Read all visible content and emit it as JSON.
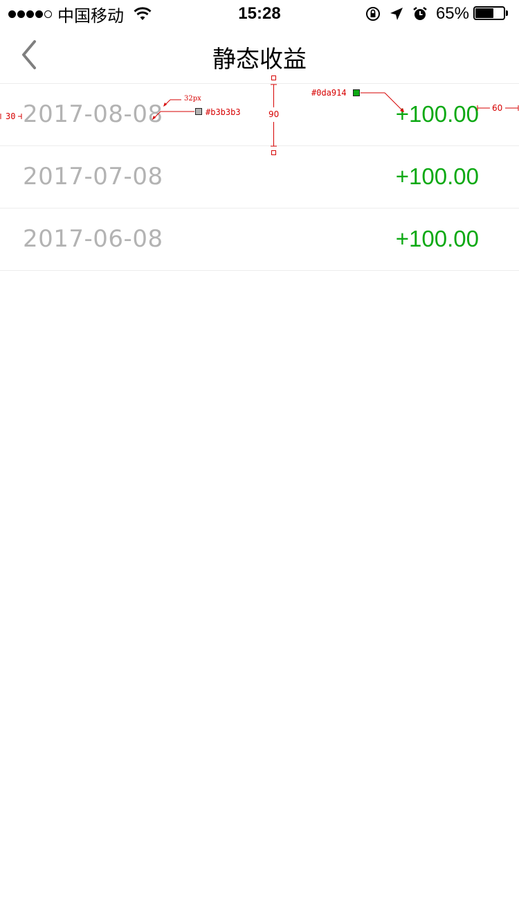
{
  "status_bar": {
    "signal_icon": "signal-dots",
    "carrier": "中国移动",
    "wifi_icon": "wifi-icon",
    "time": "15:28",
    "icons": [
      "orientation-lock-icon",
      "location-arrow-icon",
      "alarm-icon"
    ],
    "battery_percent": "65%",
    "battery_level": 0.65
  },
  "nav": {
    "back_icon": "chevron-left-icon",
    "title": "静态收益"
  },
  "rows": [
    {
      "date": "2017-08-08",
      "amount": "+100.00"
    },
    {
      "date": "2017-07-08",
      "amount": "+100.00"
    },
    {
      "date": "2017-06-08",
      "amount": "+100.00"
    }
  ],
  "colors": {
    "date_text": "#b3b3b3",
    "amount_text": "#0da914",
    "annotation": "#d60000"
  },
  "annotations": {
    "left_padding": "30",
    "font_size": "32px",
    "date_color": "#b3b3b3",
    "row_height": "90",
    "amount_color": "#0da914",
    "right_padding": "60"
  }
}
